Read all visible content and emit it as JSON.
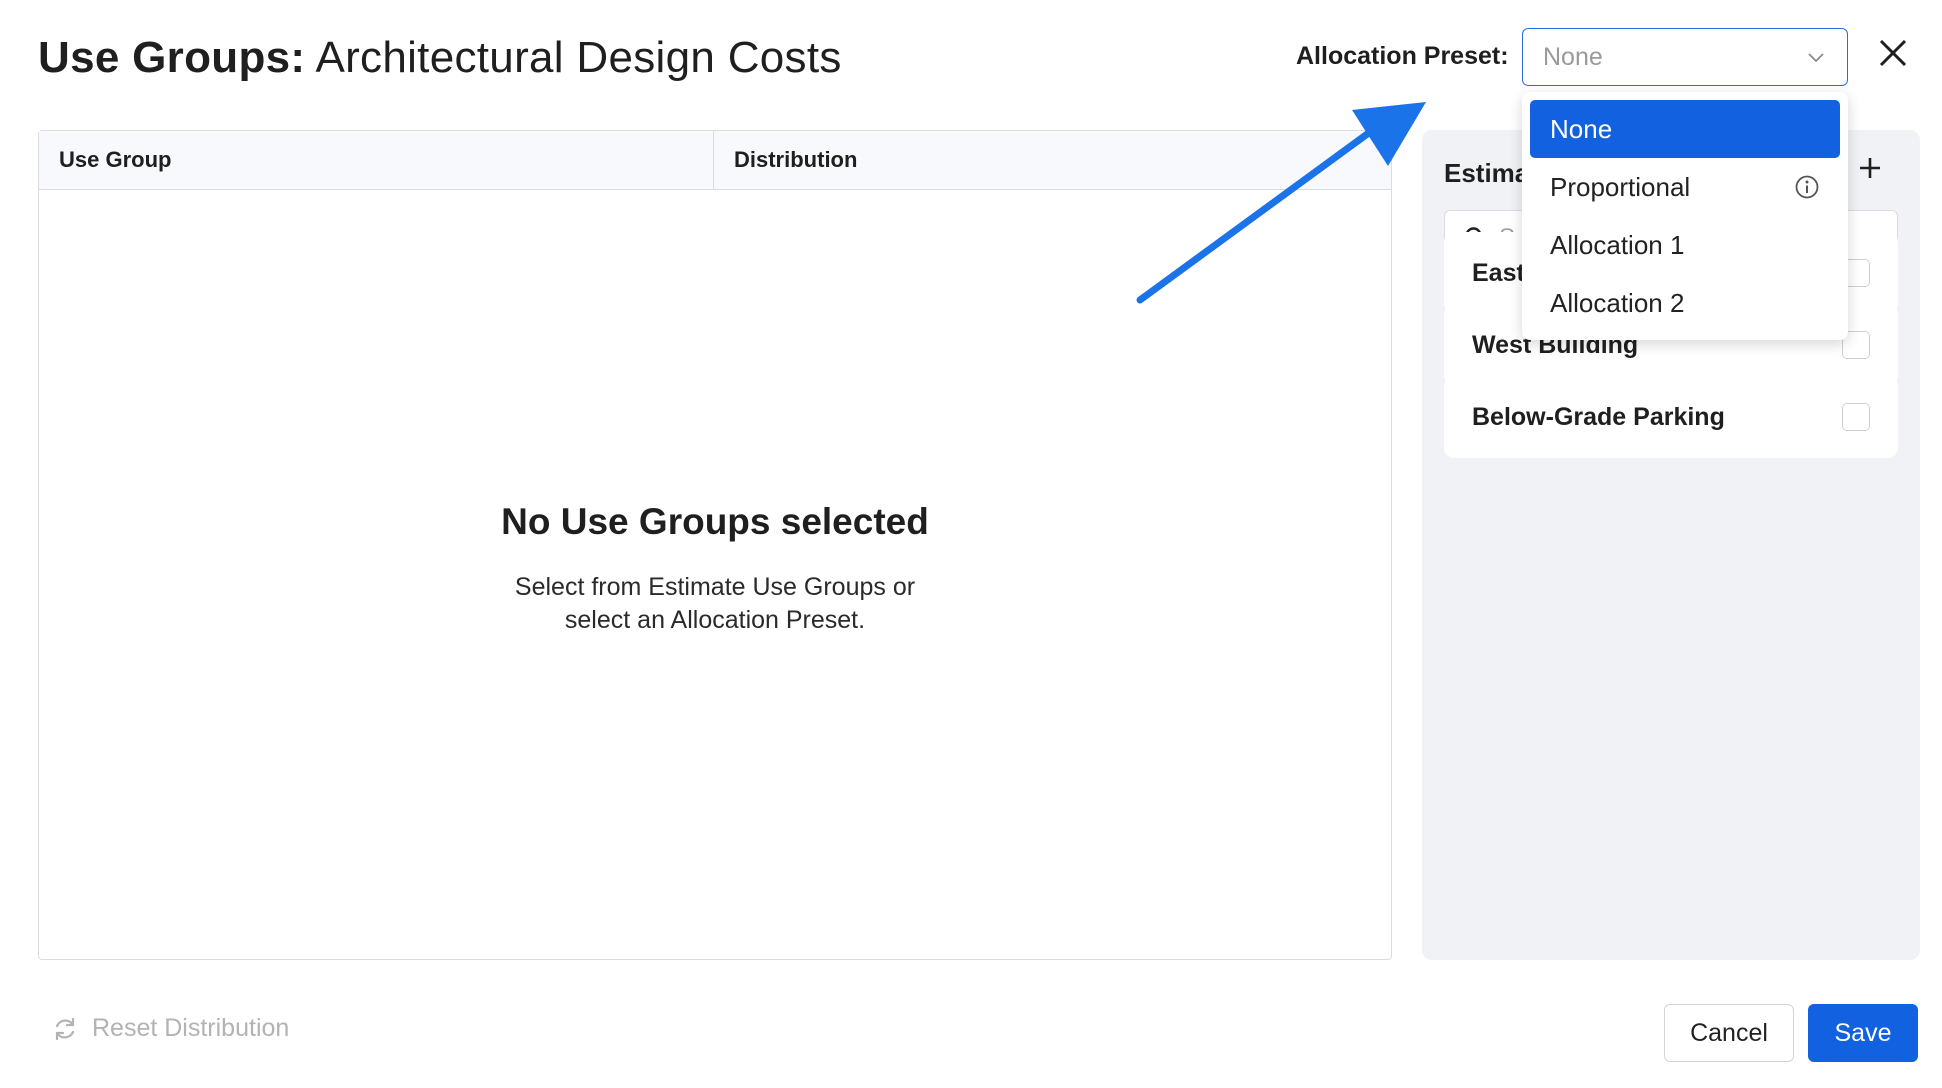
{
  "header": {
    "title_strong": "Use Groups:",
    "title_light": " Architectural Design Costs",
    "preset_label": "Allocation Preset:",
    "preset_value": "None"
  },
  "table": {
    "columns": [
      "Use Group",
      "Distribution"
    ],
    "empty_title": "No Use Groups selected",
    "empty_line1": "Select from Estimate Use Groups or",
    "empty_line2": "select an Allocation Preset."
  },
  "right_panel": {
    "title": "Estima",
    "search_placeholder": "Se",
    "use_groups": [
      {
        "name": "East"
      },
      {
        "name": "West Building"
      },
      {
        "name": "Below-Grade Parking"
      }
    ]
  },
  "dropdown": {
    "options": [
      "None",
      "Proportional",
      "Allocation 1",
      "Allocation 2"
    ],
    "selected": "None"
  },
  "footer": {
    "reset_label": "Reset Distribution",
    "cancel_label": "Cancel",
    "save_label": "Save"
  },
  "colors": {
    "primary": "#1261e0",
    "annotation_arrow": "#1a73e8"
  },
  "icons": [
    "chevron-down-icon",
    "close-icon",
    "plus-icon",
    "search-icon",
    "info-icon",
    "refresh-icon",
    "arrow-annotation"
  ]
}
